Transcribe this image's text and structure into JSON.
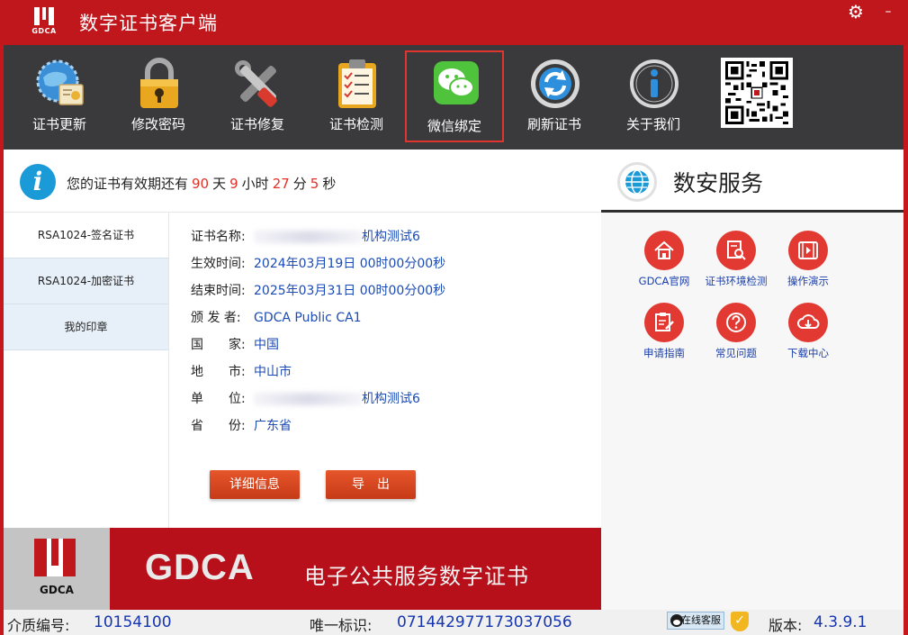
{
  "app": {
    "title": "数字证书客户端",
    "logo_text": "GDCA"
  },
  "window": {
    "settings_glyph": "⚙",
    "minimize_glyph": "–"
  },
  "toolbar": {
    "items": [
      {
        "label": "证书更新",
        "icon": "certificate-update-icon"
      },
      {
        "label": "修改密码",
        "icon": "padlock-icon"
      },
      {
        "label": "证书修复",
        "icon": "tools-icon"
      },
      {
        "label": "证书检测",
        "icon": "clipboard-check-icon"
      },
      {
        "label": "微信绑定",
        "icon": "wechat-icon",
        "active": true
      },
      {
        "label": "刷新证书",
        "icon": "refresh-icon"
      },
      {
        "label": "关于我们",
        "icon": "info-icon"
      }
    ]
  },
  "validity": {
    "prefix": "您的证书有效期还有",
    "days": "90",
    "days_unit": "天",
    "hours": "9",
    "hours_unit": "小时",
    "minutes": "27",
    "minutes_unit": "分",
    "seconds": "5",
    "seconds_unit": "秒"
  },
  "cert_list": [
    {
      "label": "RSA1024-签名证书",
      "selected": true
    },
    {
      "label": "RSA1024-加密证书"
    },
    {
      "label": "我的印章"
    }
  ],
  "details": {
    "name_label": "证书名称:",
    "name_value": "机构测试6",
    "start_label": "生效时间:",
    "start_value": "2024年03月19日 00时00分00秒",
    "end_label": "结束时间:",
    "end_value": "2025年03月31日 00时00分00秒",
    "issuer_label": "颁 发 者:",
    "issuer_value": "GDCA Public CA1",
    "country_label": "国　　家:",
    "country_value": "中国",
    "city_label": "地　　市:",
    "city_value": "中山市",
    "org_label": "单　　位:",
    "org_value": "机构测试6",
    "province_label": "省　　份:",
    "province_value": "广东省"
  },
  "buttons": {
    "detail": "详细信息",
    "export": "导　出"
  },
  "banner": {
    "logo_text": "GDCA",
    "brand": "GDCA",
    "slogan": "电子公共服务数字证书"
  },
  "services": {
    "title": "数安服务",
    "items": [
      {
        "label": "GDCA官网",
        "icon": "home-icon"
      },
      {
        "label": "证书环境检测",
        "icon": "document-search-icon"
      },
      {
        "label": "操作演示",
        "icon": "video-icon"
      },
      {
        "label": "申请指南",
        "icon": "edit-document-icon"
      },
      {
        "label": "常见问题",
        "icon": "question-icon"
      },
      {
        "label": "下载中心",
        "icon": "cloud-download-icon"
      }
    ]
  },
  "status": {
    "media_label": "介质编号:",
    "media_value": "10154100",
    "uid_label": "唯一标识:",
    "uid_value": "071442977173037056",
    "online_label": "在线客服",
    "version_label": "版本:",
    "version_value": "4.3.9.1"
  },
  "colors": {
    "brand_red": "#c0171c",
    "toolbar_bg": "#3a3a3c",
    "accent_blue": "#1b4bb5",
    "countdown_red": "#e53026",
    "service_red": "#e23a32"
  }
}
